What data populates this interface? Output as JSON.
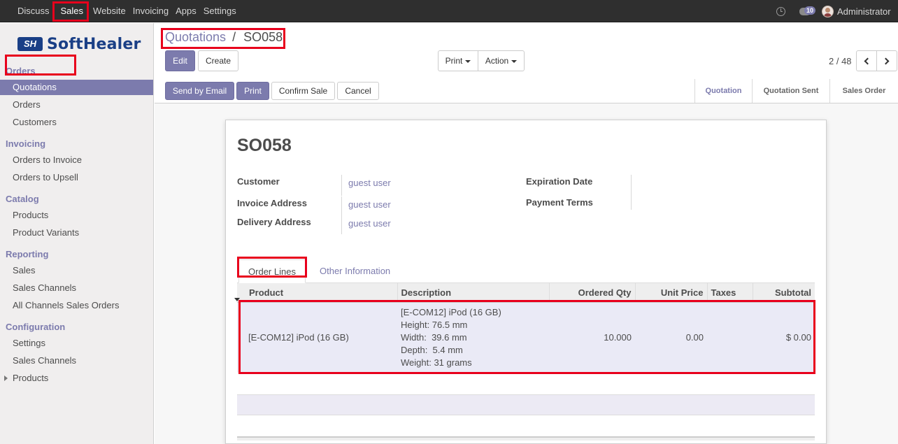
{
  "topbar": {
    "menu": [
      "Discuss",
      "Sales",
      "Website",
      "Invoicing",
      "Apps",
      "Settings"
    ],
    "active": "Sales",
    "chat_count": "10",
    "user": "Administrator"
  },
  "logo": {
    "mark": "SH",
    "text": "SoftHealer"
  },
  "sidebar": {
    "sections": [
      {
        "title": "Orders",
        "items": [
          "Quotations",
          "Orders",
          "Customers"
        ]
      },
      {
        "title": "Invoicing",
        "items": [
          "Orders to Invoice",
          "Orders to Upsell"
        ]
      },
      {
        "title": "Catalog",
        "items": [
          "Products",
          "Product Variants"
        ]
      },
      {
        "title": "Reporting",
        "items": [
          "Sales",
          "Sales Channels",
          "All Channels Sales Orders"
        ]
      },
      {
        "title": "Configuration",
        "items": [
          "Settings",
          "Sales Channels",
          "Products"
        ]
      }
    ],
    "active_item": "Quotations"
  },
  "breadcrumb": {
    "parent": "Quotations",
    "separator": "/",
    "current": "SO058"
  },
  "buttons": {
    "edit": "Edit",
    "create": "Create",
    "print": "Print",
    "action": "Action",
    "send_email": "Send by Email",
    "print2": "Print",
    "confirm": "Confirm Sale",
    "cancel": "Cancel"
  },
  "pager": {
    "value": "2 / 48"
  },
  "stages": [
    "Quotation",
    "Quotation Sent",
    "Sales Order"
  ],
  "current_stage": "Quotation",
  "record": {
    "name": "SO058",
    "customer_label": "Customer",
    "customer": "guest user",
    "invoice_label": "Invoice Address",
    "invoice": "guest user",
    "delivery_label": "Delivery Address",
    "delivery": "guest user",
    "expiration_label": "Expiration Date",
    "payment_label": "Payment Terms"
  },
  "tabs": [
    "Order Lines",
    "Other Information"
  ],
  "lines": {
    "headers": [
      "Product",
      "Description",
      "Ordered Qty",
      "Unit Price",
      "Taxes",
      "Subtotal"
    ],
    "rows": [
      {
        "product": "[E-COM12] iPod (16 GB)",
        "description": [
          "[E-COM12] iPod (16 GB)",
          "Height: 76.5 mm",
          "Width:  39.6 mm",
          "Depth:  5.4 mm",
          "Weight: 31 grams"
        ],
        "qty": "10.000",
        "price": "0.00",
        "taxes": "",
        "subtotal": "$ 0.00"
      }
    ]
  },
  "colors": {
    "accent": "#7c7bad",
    "highlight": "#e8001c",
    "topbar": "#2f2f2f"
  }
}
